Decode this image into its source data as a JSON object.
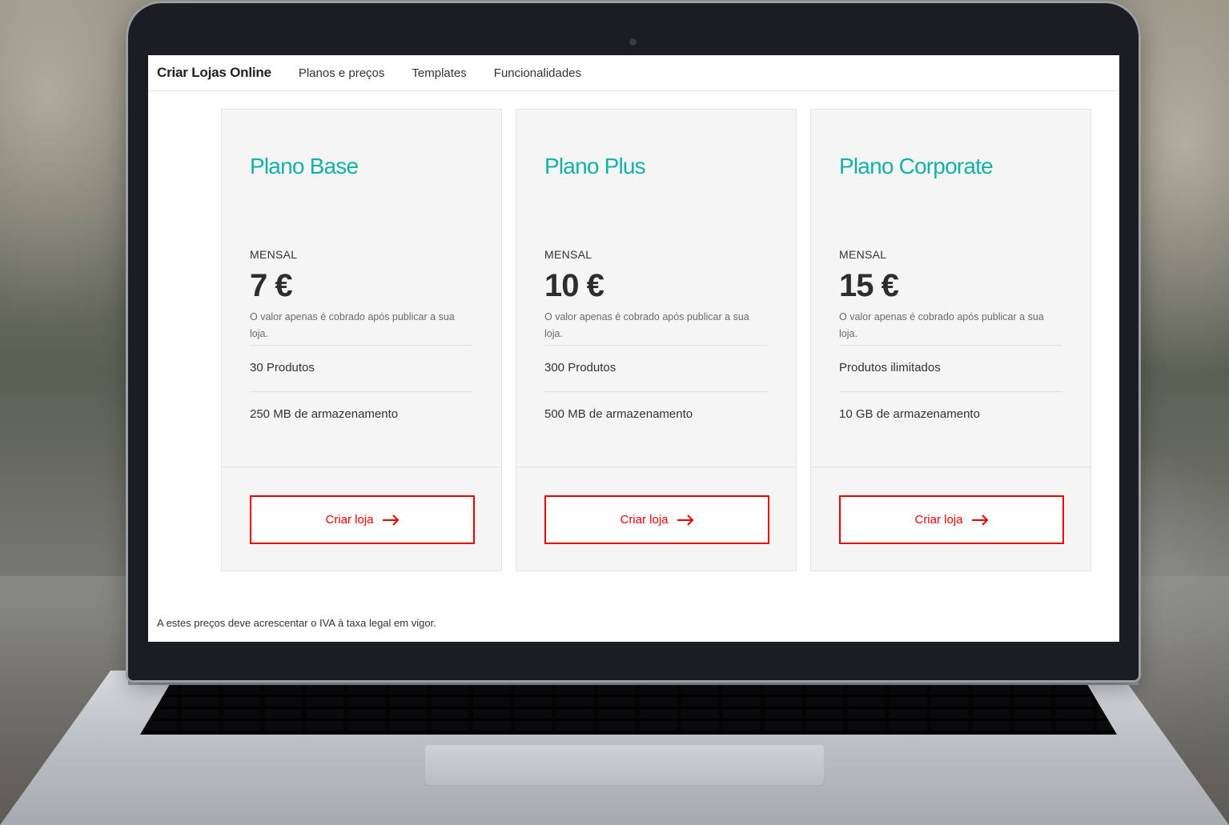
{
  "nav": {
    "brand": "Criar Lojas Online",
    "links": [
      "Planos e preços",
      "Templates",
      "Funcionalidades"
    ]
  },
  "plans": [
    {
      "name": "Plano Base",
      "period": "MENSAL",
      "price": "7 €",
      "note": "O valor apenas é cobrado após publicar a sua loja.",
      "products": "30 Produtos",
      "storage": "250 MB de armazenamento",
      "cta": "Criar loja"
    },
    {
      "name": "Plano Plus",
      "period": "MENSAL",
      "price": "10 €",
      "note": "O valor apenas é cobrado após publicar a sua loja.",
      "products": "300 Produtos",
      "storage": "500 MB de armazenamento",
      "cta": "Criar loja"
    },
    {
      "name": "Plano Corporate",
      "period": "MENSAL",
      "price": "15 €",
      "note": "O valor apenas é cobrado após publicar a sua loja.",
      "products": "Produtos ilimitados",
      "storage": "10 GB de armazenamento",
      "cta": "Criar loja"
    }
  ],
  "disclaimer": "A estes preços deve acrescentar o IVA à taxa legal em vigor.",
  "colors": {
    "accent_teal": "#14b1a6",
    "cta_red": "#e60000",
    "card_bg": "#f4f5f4"
  },
  "icons": {
    "cta_icon": "arrow-right-icon"
  }
}
